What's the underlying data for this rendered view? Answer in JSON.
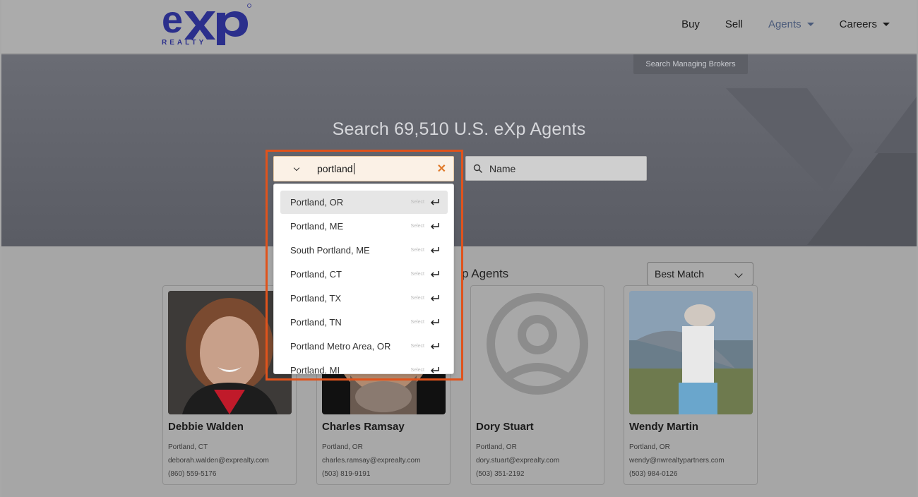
{
  "brand": {
    "logo_text": "eXp",
    "logo_sub": "REALTY",
    "color_blue": "#2b2f8c",
    "accent": "#e0531c"
  },
  "nav": {
    "items": [
      {
        "label": "Buy",
        "has_caret": false
      },
      {
        "label": "Sell",
        "has_caret": false
      },
      {
        "label": "Agents",
        "has_caret": true,
        "active": true
      },
      {
        "label": "Careers",
        "has_caret": true
      }
    ]
  },
  "hero": {
    "broker_button": "Search Managing Brokers",
    "title": "Search 69,510 U.S. eXp Agents"
  },
  "location_search": {
    "value": "portland",
    "clear_icon": "close-icon",
    "suggestions": [
      {
        "label": "Portland, OR",
        "hint": "Select"
      },
      {
        "label": "Portland, ME",
        "hint": "Select"
      },
      {
        "label": "South Portland, ME",
        "hint": "Select"
      },
      {
        "label": "Portland, CT",
        "hint": "Select"
      },
      {
        "label": "Portland, TX",
        "hint": "Select"
      },
      {
        "label": "Portland, TN",
        "hint": "Select"
      },
      {
        "label": "Portland Metro Area, OR",
        "hint": "Select"
      },
      {
        "label": "Portland, MI",
        "hint": "Select"
      }
    ]
  },
  "name_search": {
    "placeholder": "Name"
  },
  "results": {
    "title_visible": "p Agents",
    "sort_value": "Best Match"
  },
  "agents": [
    {
      "name": "Debbie Walden",
      "location": "Portland, CT",
      "email": "deborah.walden@exprealty.com",
      "phone": "(860) 559-5176"
    },
    {
      "name": "Charles Ramsay",
      "location": "Portland, OR",
      "email": "charles.ramsay@exprealty.com",
      "phone": "(503) 819-9191"
    },
    {
      "name": "Dory Stuart",
      "location": "Portland, OR",
      "email": "dory.stuart@exprealty.com",
      "phone": "(503) 351-2192"
    },
    {
      "name": "Wendy Martin",
      "location": "Portland, OR",
      "email": "wendy@nwrealtypartners.com",
      "phone": "(503) 984-0126"
    }
  ]
}
